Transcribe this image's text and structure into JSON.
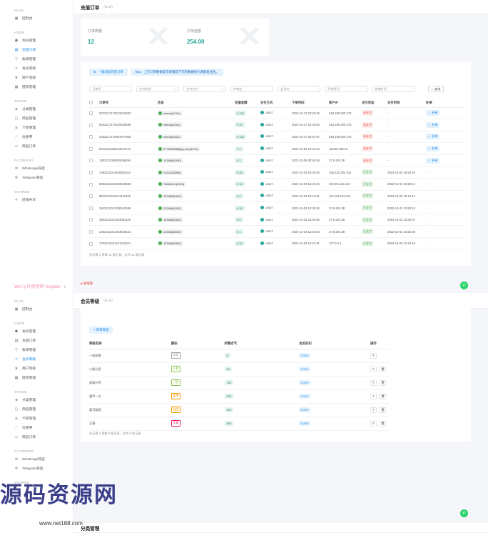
{
  "sidebar": {
    "brand": "WeTg 外贸营销 Supplier",
    "main_label": "MAIN",
    "dashboard": "控制台",
    "user_label": "USER",
    "user_items": [
      "会员管理",
      "充值订单",
      "账单管理",
      "会员等级",
      "商户等级",
      "提现管理"
    ],
    "trade_label": "TRADE",
    "trade_items": [
      "分类管理",
      "商品管理",
      "卡密管理",
      "优惠券",
      "商品订单"
    ],
    "filtering_label": "FILTERING",
    "filtering_items": [
      "WhatsApp筛选",
      "Telegram筛选"
    ],
    "shared_label": "SHARED",
    "shared_items": [
      "店铺共享"
    ]
  },
  "recharge": {
    "title": "充值订单",
    "sub": "(fa-all)",
    "stats": {
      "count_label": "订单数量",
      "count_value": "12",
      "amount_label": "订单金额",
      "amount_value": "254.00"
    },
    "sync_button": "一键添加充值订单",
    "tips": "Tips：上方订单数据提示客服前下方的数据执行调配备注后。",
    "filters": {
      "order_no": "订单号",
      "pay_status": "支付状态",
      "pay_method": "支付方式",
      "ip": "IP地址",
      "user_id": "会员ID",
      "start_time": "开始时间",
      "end_time": "结束时间",
      "search": "查询"
    },
    "columns": [
      "订单号",
      "会员",
      "充值金额",
      "支付方式",
      "下单时间",
      "客户IP",
      "支付状态",
      "支付时间",
      "补单"
    ],
    "rows": [
      {
        "no": "0472217170122151693",
        "user": "zhenfu(1014)",
        "amount": "¥ 100",
        "method": "USDT",
        "time": "2022-12-17 01:22:15",
        "ip": "218.190.230.173",
        "status": "未支付",
        "status_kind": "un",
        "paid": "-",
        "repair": "补单"
      },
      {
        "no": "0422217170120020946",
        "user": "zhenfu(1014)",
        "amount": "¥ 10",
        "method": "USDT",
        "time": "2022-12-17 01:20:02",
        "ip": "218.190.230.173",
        "status": "未支付",
        "status_kind": "un",
        "paid": "-",
        "repair": "补单"
      },
      {
        "no": "2332217170057577500",
        "user": "zhenfu(1014)",
        "amount": "¥ 100",
        "method": "USDT",
        "time": "2022-12-17 00:57:57",
        "ip": "218.190.230.173",
        "status": "未支付",
        "status_kind": "un",
        "paid": "-",
        "repair": "补单"
      },
      {
        "no": "6012212050142412774",
        "user": "277652865@qq.com(1010)",
        "amount": "¥ 1",
        "method": "USDT",
        "time": "2022-12-05 14:24:12",
        "ip": "113.88.238.22",
        "status": "未支付",
        "status_kind": "un",
        "paid": "-",
        "repair": "补单"
      },
      {
        "no": "1302212050205048354",
        "user": "123456(1000)",
        "amount": "¥ 1",
        "method": "USDT",
        "time": "2022-12-05 20:50:48",
        "ip": "27.9.224.36",
        "status": "未支付",
        "status_kind": "un",
        "paid": "-",
        "repair": "补单"
      },
      {
        "no": "1092212031649302014",
        "user": "201119(1006)",
        "amount": "¥ 10",
        "method": "USDT",
        "time": "2022-12-03 16:49:30",
        "ip": "183.222.204.214",
        "status": "已支付",
        "status_kind": "ok",
        "paid": "2022-12-03 16:50:16",
        "repair": "-"
      },
      {
        "no": "5092212031525446608",
        "user": "78451212(1004)",
        "amount": "¥ 10",
        "method": "USDT",
        "time": "2022-12-03 15:25:44",
        "ip": "202.98.124.143",
        "status": "已支付",
        "status_kind": "ok",
        "paid": "2022-12-03 15:26:41",
        "repair": "-"
      },
      {
        "no": "8812212031513411425",
        "user": "123456(1000)",
        "amount": "¥ 2",
        "method": "USDT",
        "time": "2022-12-03 15:13:41",
        "ip": "112.118.149.114",
        "status": "已支付",
        "status_kind": "ok",
        "paid": "2022-12-03 15:14:41",
        "repair": "-"
      },
      {
        "no": "3242212021338153106",
        "user": "123456(1000)",
        "amount": "¥ 10",
        "method": "USDT",
        "time": "2022-12-02 13:38:15",
        "ip": "27.9.224.38",
        "status": "已支付",
        "status_kind": "ok",
        "paid": "2022-12-02 13:40:13",
        "repair": "-"
      },
      {
        "no": "2902212021334061149",
        "user": "123456(1000)",
        "amount": "¥ 5",
        "method": "USDT",
        "time": "2022-12-02 13:34:06",
        "ip": "27.9.224.38",
        "status": "已支付",
        "status_kind": "ok",
        "paid": "2022-12-02 13:42:07",
        "repair": "-"
      },
      {
        "no": "2452212021303545423",
        "user": "123456(1000)",
        "amount": "¥ 1",
        "method": "USDT",
        "time": "2022-12-02 13:03:54",
        "ip": "27.9.224.38",
        "status": "已支付",
        "status_kind": "ok",
        "paid": "2022-12-02 13:32:39",
        "repair": "-"
      },
      {
        "no": "1702212021241311044",
        "user": "123456(1000)",
        "amount": "¥ 10",
        "method": "USDT",
        "time": "2022-12-02 12:41:31",
        "ip": "127.0.0.1",
        "status": "已支付",
        "status_kind": "ok",
        "paid": "2022-12-02 12:44:16",
        "repair": "-"
      }
    ],
    "footer": "显示第 1 到第 12 条记录，总共 12 条记录",
    "logout": "● 离线版"
  },
  "levels": {
    "title": "会员等级",
    "sub": "(fa-all)",
    "add_button": "+ 新增等级",
    "columns": [
      "等级名称",
      "图标",
      "所需点气",
      "会员折扣",
      "操作"
    ],
    "rows": [
      {
        "name": "一般顾客",
        "icon": "顾客",
        "points": "0",
        "discount": "0.00%",
        "color": "#9e9e9e"
      },
      {
        "name": "小额之家",
        "icon": "小额",
        "points": "50",
        "discount": "0.00%",
        "color": "#8bc34a"
      },
      {
        "name": "超级万贯",
        "icon": "万贯",
        "points": "100",
        "discount": "0.00%",
        "color": "#8bc34a"
      },
      {
        "name": "富甲一方",
        "icon": "富甲",
        "points": "200",
        "discount": "0.00%",
        "color": "#ff9800"
      },
      {
        "name": "富可敌国",
        "icon": "敌国",
        "points": "300",
        "discount": "0.00%",
        "color": "#ff9800"
      },
      {
        "name": "至尊",
        "icon": "至尊",
        "points": "500",
        "discount": "0.00%",
        "color": "#e91e63"
      }
    ],
    "footer": "显示第 1 到第 6 条记录，总共 6 条记录"
  },
  "next_title": "分类管理",
  "watermark": {
    "text": "源码资源网",
    "url": "www.net188.com"
  }
}
